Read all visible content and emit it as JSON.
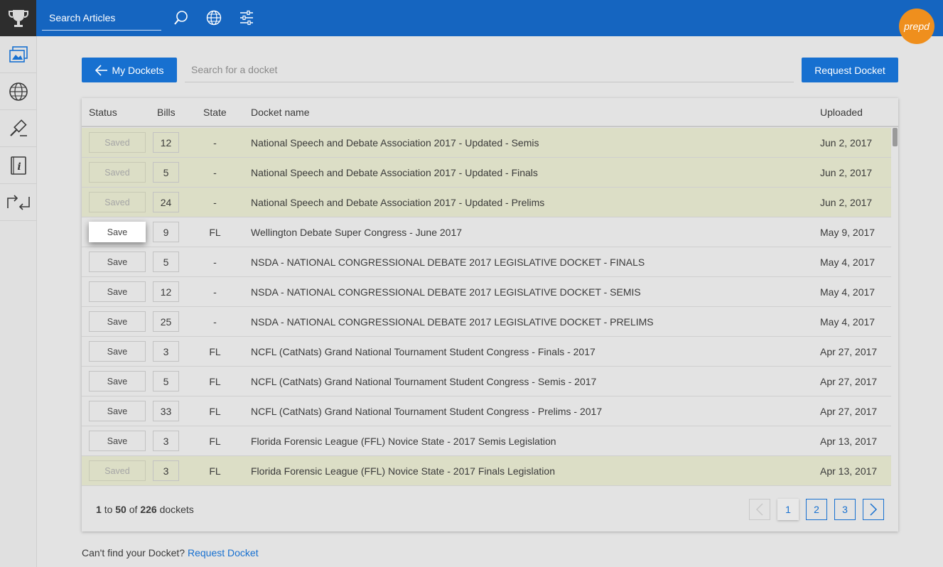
{
  "topbar": {
    "search_placeholder": "Search Articles",
    "icons": [
      "trophy-icon",
      "search-icon",
      "globe-icon",
      "sliders-icon"
    ],
    "avatar_text": "prepd",
    "brand_color": "#1565c0",
    "avatar_color": "#ef8f1d"
  },
  "sidebar": {
    "items": [
      "dockets-icon",
      "globe-icon",
      "gavel-icon",
      "info-book-icon",
      "swap-arrows-icon"
    ]
  },
  "toolbar": {
    "back_label": "My Dockets",
    "search_placeholder": "Search for a docket",
    "request_label": "Request Docket"
  },
  "table": {
    "headers": {
      "status": "Status",
      "bills": "Bills",
      "state": "State",
      "name": "Docket name",
      "uploaded": "Uploaded"
    },
    "rows": [
      {
        "status": "Saved",
        "bills": "12",
        "state": "-",
        "name": "National Speech and Debate Association 2017 - Updated - Semis",
        "uploaded": "Jun 2, 2017"
      },
      {
        "status": "Saved",
        "bills": "5",
        "state": "-",
        "name": "National Speech and Debate Association 2017 - Updated - Finals",
        "uploaded": "Jun 2, 2017"
      },
      {
        "status": "Saved",
        "bills": "24",
        "state": "-",
        "name": "National Speech and Debate Association 2017 - Updated - Prelims",
        "uploaded": "Jun 2, 2017"
      },
      {
        "status": "Save",
        "bills": "9",
        "state": "FL",
        "name": "Wellington Debate Super Congress - June 2017",
        "uploaded": "May 9, 2017"
      },
      {
        "status": "Save",
        "bills": "5",
        "state": "-",
        "name": "NSDA - NATIONAL CONGRESSIONAL DEBATE 2017 LEGISLATIVE DOCKET - FINALS",
        "uploaded": "May 4, 2017"
      },
      {
        "status": "Save",
        "bills": "12",
        "state": "-",
        "name": "NSDA - NATIONAL CONGRESSIONAL DEBATE 2017 LEGISLATIVE DOCKET - SEMIS",
        "uploaded": "May 4, 2017"
      },
      {
        "status": "Save",
        "bills": "25",
        "state": "-",
        "name": "NSDA - NATIONAL CONGRESSIONAL DEBATE 2017 LEGISLATIVE DOCKET - PRELIMS",
        "uploaded": "May 4, 2017"
      },
      {
        "status": "Save",
        "bills": "3",
        "state": "FL",
        "name": "NCFL (CatNats) Grand National Tournament Student Congress - Finals - 2017",
        "uploaded": "Apr 27, 2017"
      },
      {
        "status": "Save",
        "bills": "5",
        "state": "FL",
        "name": "NCFL (CatNats) Grand National Tournament Student Congress - Semis - 2017",
        "uploaded": "Apr 27, 2017"
      },
      {
        "status": "Save",
        "bills": "33",
        "state": "FL",
        "name": "NCFL (CatNats) Grand National Tournament Student Congress - Prelims - 2017",
        "uploaded": "Apr 27, 2017"
      },
      {
        "status": "Save",
        "bills": "3",
        "state": "FL",
        "name": "Florida Forensic League (FFL) Novice State - 2017 Semis Legislation",
        "uploaded": "Apr 13, 2017"
      },
      {
        "status": "Saved",
        "bills": "3",
        "state": "FL",
        "name": "Florida Forensic League (FFL) Novice State - 2017 Finals Legislation",
        "uploaded": "Apr 13, 2017"
      }
    ]
  },
  "pagination": {
    "from": "1",
    "to_word": "to",
    "to": "50",
    "of_word": "of",
    "total": "226",
    "unit": "dockets",
    "pages": [
      "1",
      "2",
      "3"
    ],
    "current_page": "1"
  },
  "footer": {
    "text": "Can't find your Docket?",
    "link": "Request Docket"
  }
}
